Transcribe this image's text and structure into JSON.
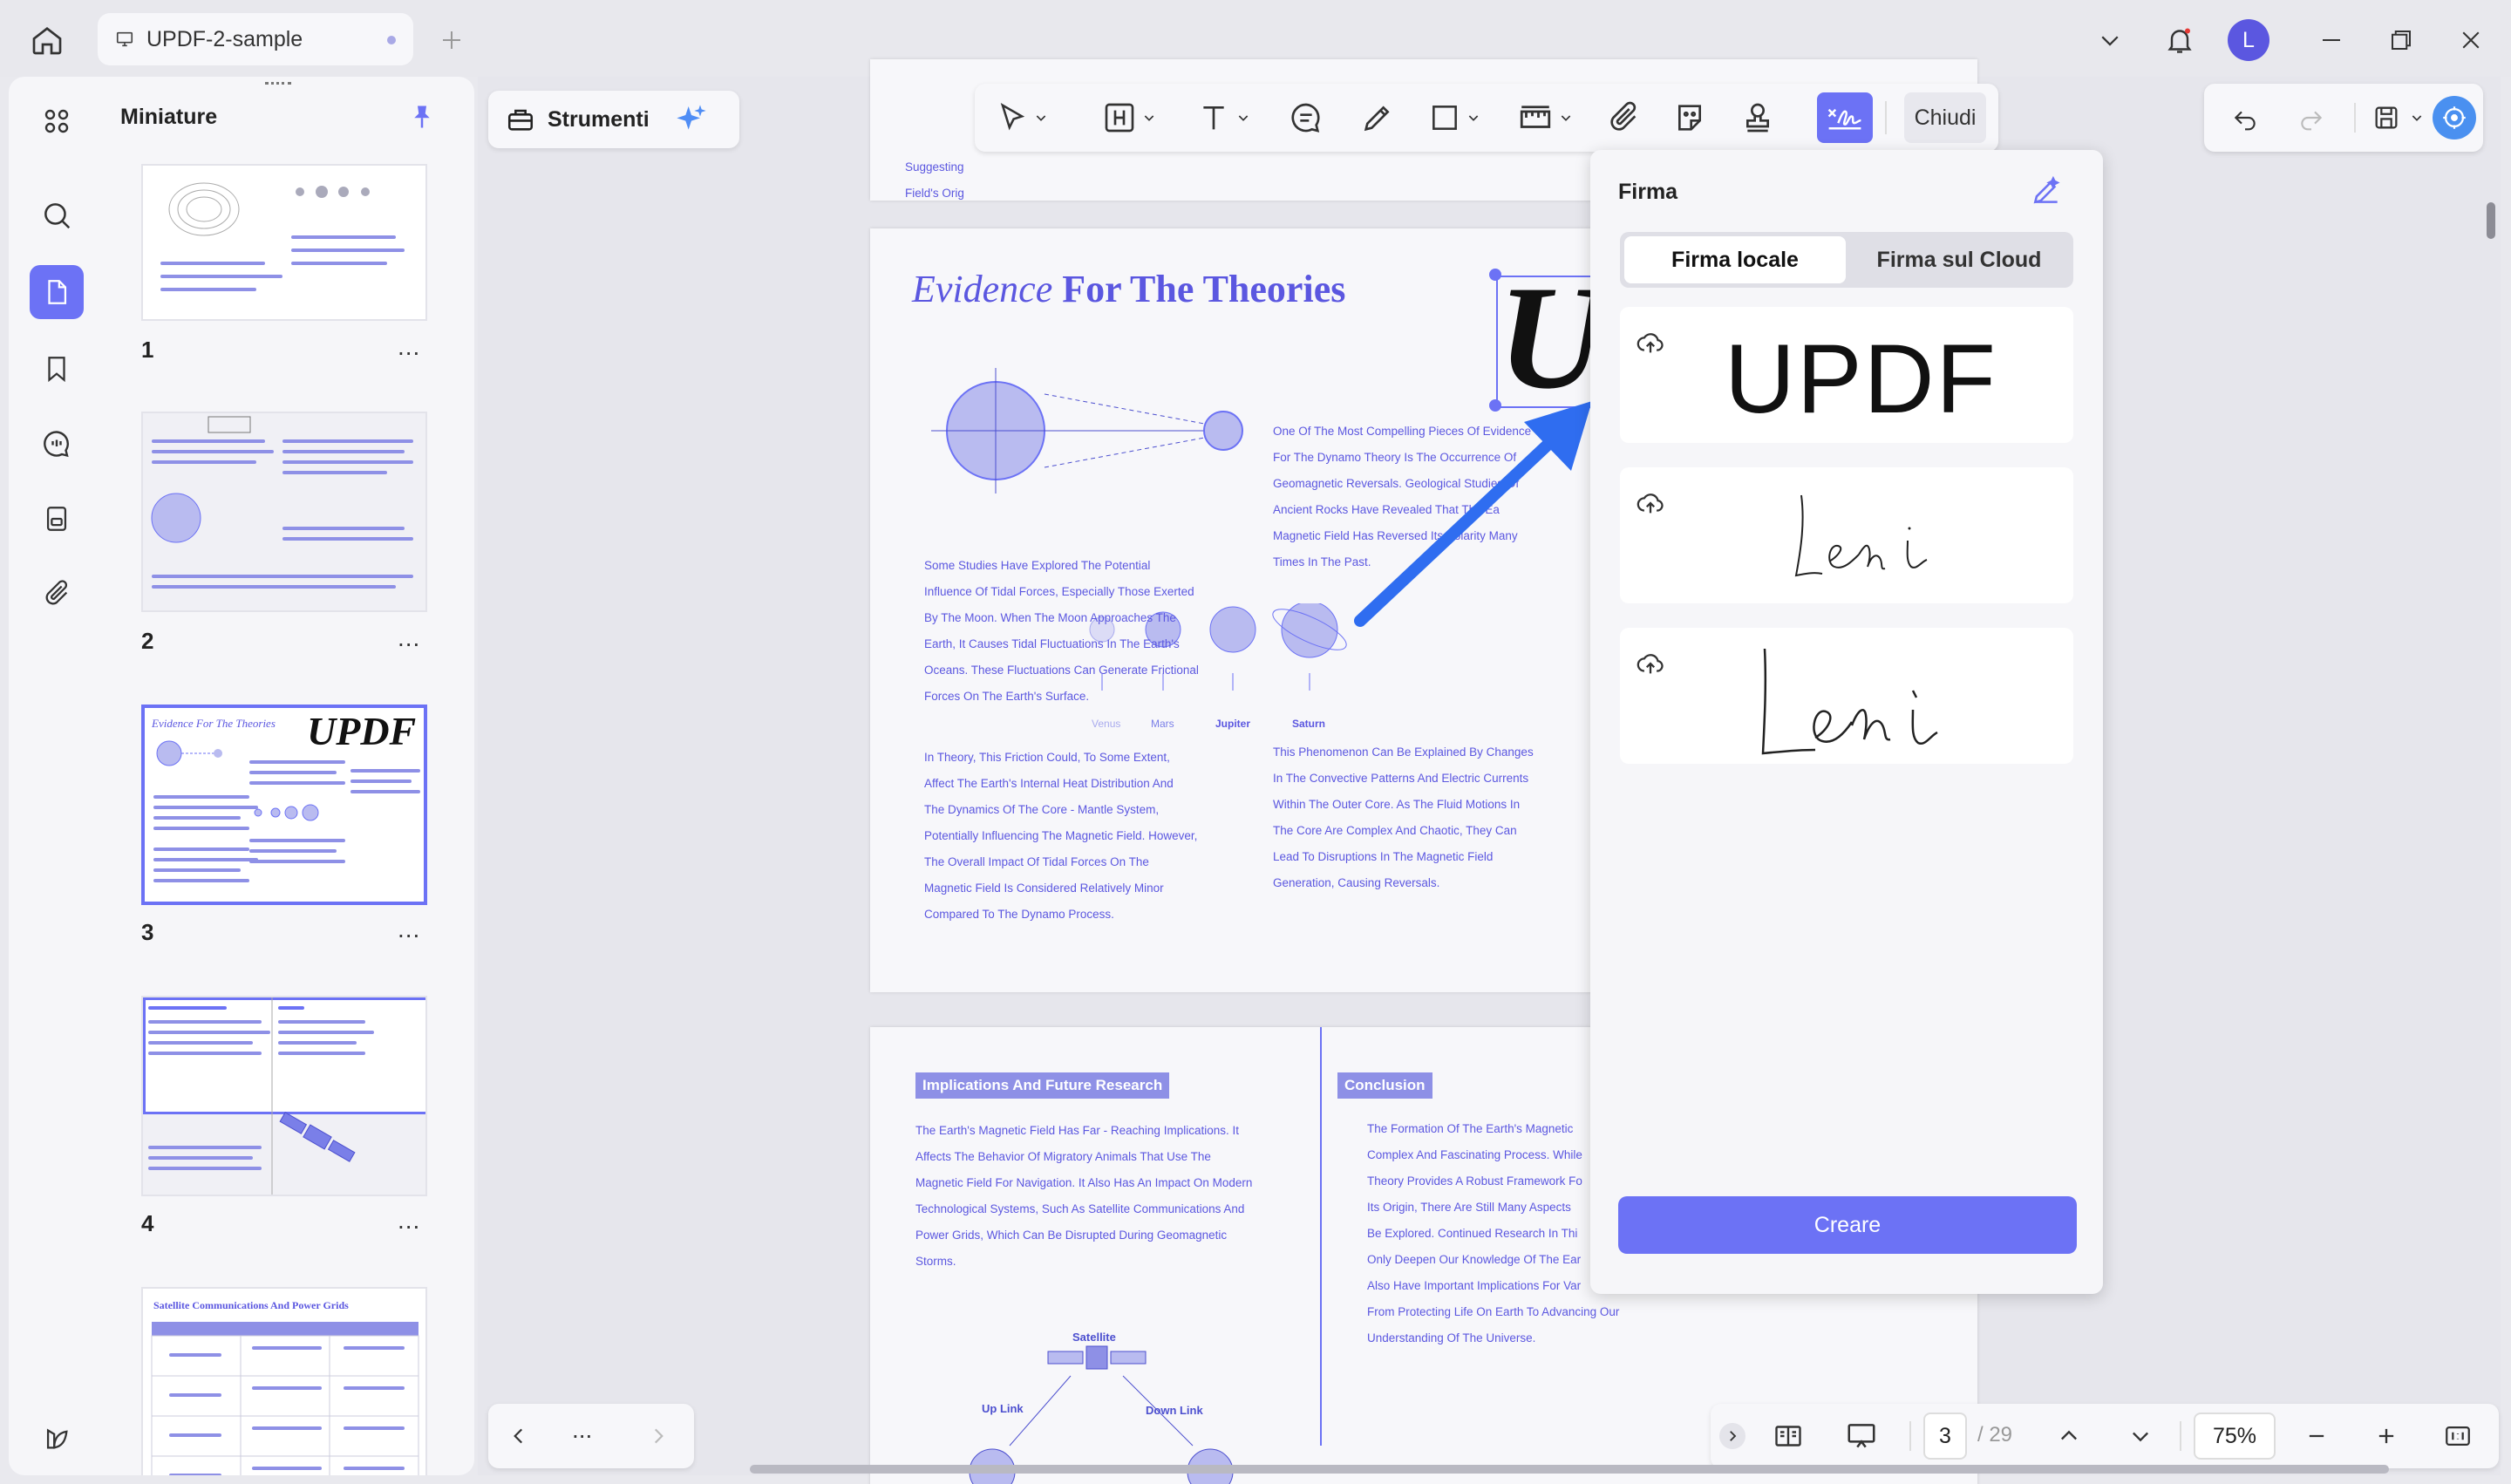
{
  "tab": {
    "title": "UPDF-2-sample"
  },
  "user": {
    "initial": "L"
  },
  "sidebar": {
    "title": "Miniature",
    "pages": [
      {
        "label": "1"
      },
      {
        "label": "2"
      },
      {
        "label": "3"
      },
      {
        "label": "4"
      }
    ],
    "more": "...",
    "thumb3_logo": "UPDF",
    "thumb3_title": "Evidence For The Theories",
    "thumb5_title": "Satellite Communications And Power Grids"
  },
  "toolbar": {
    "tools_label": "Strumenti",
    "close_label": "Chiudi"
  },
  "document": {
    "page_top": {
      "snippet_1": "Suggesting",
      "snippet_2": "Field's Orig"
    },
    "page3": {
      "title_italic": "Evidence",
      "title_bold": "For The Theories",
      "signature_big": "U",
      "para1": [
        "One Of The Most Compelling Pieces Of Evidence",
        "For The Dynamo Theory Is The Occurrence Of",
        "Geomagnetic Reversals. Geological Studies Of",
        "Ancient Rocks Have Revealed That The Ea",
        "Magnetic Field Has Reversed Its Polarity Many",
        "Times In The Past."
      ],
      "para2": [
        "Some Studies Have Explored The Potential",
        "Influence Of Tidal Forces, Especially Those Exerted",
        "By The Moon. When The Moon Approaches The",
        "Earth, It Causes Tidal Fluctuations In The Earth's",
        "Oceans. These Fluctuations Can Generate Frictional",
        "Forces On The Earth's Surface."
      ],
      "para3": [
        " In Theory, This Friction Could, To Some Extent,",
        "Affect The Earth's Internal Heat Distribution And",
        "The Dynamics Of The Core - Mantle System,",
        "Potentially Influencing The Magnetic Field. However,",
        "The Overall Impact Of Tidal Forces On The",
        "Magnetic Field Is Considered Relatively Minor",
        "Compared To The Dynamo Process."
      ],
      "para4": [
        "This Phenomenon Can Be Explained By Changes",
        "In The Convective Patterns And Electric Currents",
        "Within The Outer Core. As The Fluid Motions In",
        "The Core Are Complex And Chaotic, They Can",
        "Lead To Disruptions In The Magnetic Field",
        "Generation, Causing Reversals."
      ],
      "planets": [
        "Venus",
        "Mars",
        "Jupiter",
        "Saturn"
      ]
    },
    "page4": {
      "heading_left": "Implications And Future Research",
      "heading_right": "Conclusion",
      "para_left": [
        "The Earth's Magnetic Field Has Far - Reaching Implications. It",
        "Affects The Behavior Of Migratory Animals That Use The",
        "Magnetic Field For Navigation. It Also Has An Impact On Modern",
        "Technological Systems, Such As Satellite Communications And",
        "Power Grids, Which Can Be Disrupted During Geomagnetic",
        "Storms."
      ],
      "para_right": [
        "The Formation Of The Earth's Magnetic",
        "Complex And Fascinating Process. While",
        "Theory Provides A Robust Framework Fo",
        "Its Origin, There Are Still Many Aspects",
        "Be Explored. Continued Research In Thi",
        "Only Deepen Our Knowledge Of The Ear",
        "Also Have Important Implications For Var",
        "From Protecting Life On Earth To Advancing Our",
        "Understanding Of The Universe."
      ],
      "diagram": {
        "satellite": "Satellite",
        "uplink": "Up Link",
        "downlink": "Down Link"
      }
    }
  },
  "signature_panel": {
    "title": "Firma",
    "tab_local": "Firma locale",
    "tab_cloud": "Firma sul Cloud",
    "sig1_text": "UPDF",
    "create_label": "Creare"
  },
  "pagination": {
    "current": "3",
    "total": "/ 29",
    "zoom": "75%"
  },
  "nav": {
    "more": "..."
  },
  "colors": {
    "accent": "#6c72f5",
    "doc_text": "#5b57e0",
    "arrow": "#2f6df0"
  }
}
